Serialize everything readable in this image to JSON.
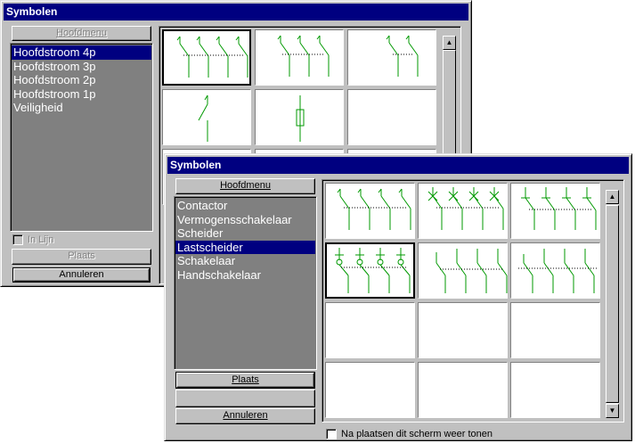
{
  "back_window": {
    "title": "Symbolen",
    "menu_button": "Hoofdmenu",
    "list_items": [
      "Hoofdstroom 4p",
      "Hoofdstroom 3p",
      "Hoofdstroom 2p",
      "Hoofdstroom 1p",
      "Veiligheid"
    ],
    "selected_index": 0,
    "inline_checkbox": "In Lijn",
    "place_button": "Plaats",
    "cancel_button": "Annuleren"
  },
  "front_window": {
    "title": "Symbolen",
    "menu_button": "Hoofdmenu",
    "list_items": [
      "Contactor",
      "Vermogensschakelaar",
      "Scheider",
      "Lastscheider",
      "Schakelaar",
      "Handschakelaar"
    ],
    "selected_index": 3,
    "place_button": "Plaats",
    "cancel_button": "Annuleren",
    "reopen_checkbox": "Na plaatsen dit scherm weer tonen"
  },
  "colors": {
    "titlebar": "#000080",
    "list_bg": "#808080",
    "symbol_stroke": "#009900",
    "face": "#c0c0c0"
  }
}
